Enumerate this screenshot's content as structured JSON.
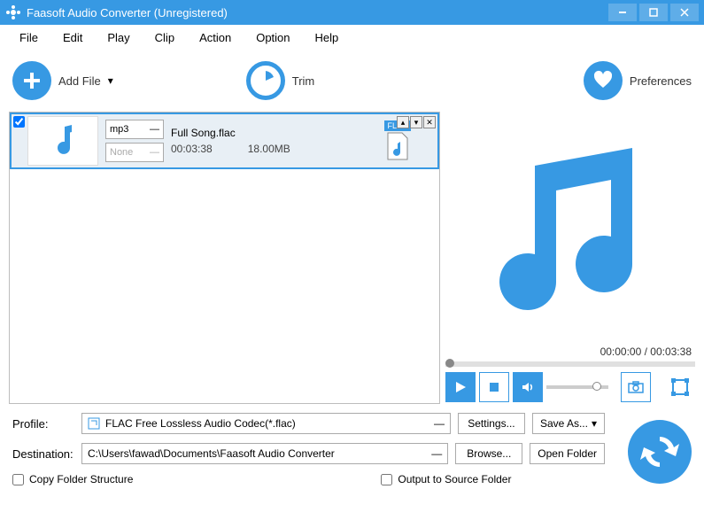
{
  "window": {
    "title": "Faasoft Audio Converter (Unregistered)"
  },
  "menu": {
    "file": "File",
    "edit": "Edit",
    "play": "Play",
    "clip": "Clip",
    "action": "Action",
    "option": "Option",
    "help": "Help"
  },
  "toolbar": {
    "add_file": "Add File",
    "trim": "Trim",
    "preferences": "Preferences"
  },
  "file": {
    "checked": true,
    "format_sel": "mp3",
    "effect_sel": "None",
    "name": "Full Song.flac",
    "duration": "00:03:38",
    "size": "18.00MB",
    "badge": "FLAC"
  },
  "preview": {
    "time": "00:00:00 / 00:03:38"
  },
  "profile": {
    "label": "Profile:",
    "value": "FLAC Free Lossless Audio Codec(*.flac)",
    "settings": "Settings...",
    "saveas": "Save As..."
  },
  "destination": {
    "label": "Destination:",
    "value": "C:\\Users\\fawad\\Documents\\Faasoft Audio Converter",
    "browse": "Browse...",
    "open": "Open Folder"
  },
  "checks": {
    "copy": "Copy Folder Structure",
    "output_src": "Output to Source Folder"
  }
}
